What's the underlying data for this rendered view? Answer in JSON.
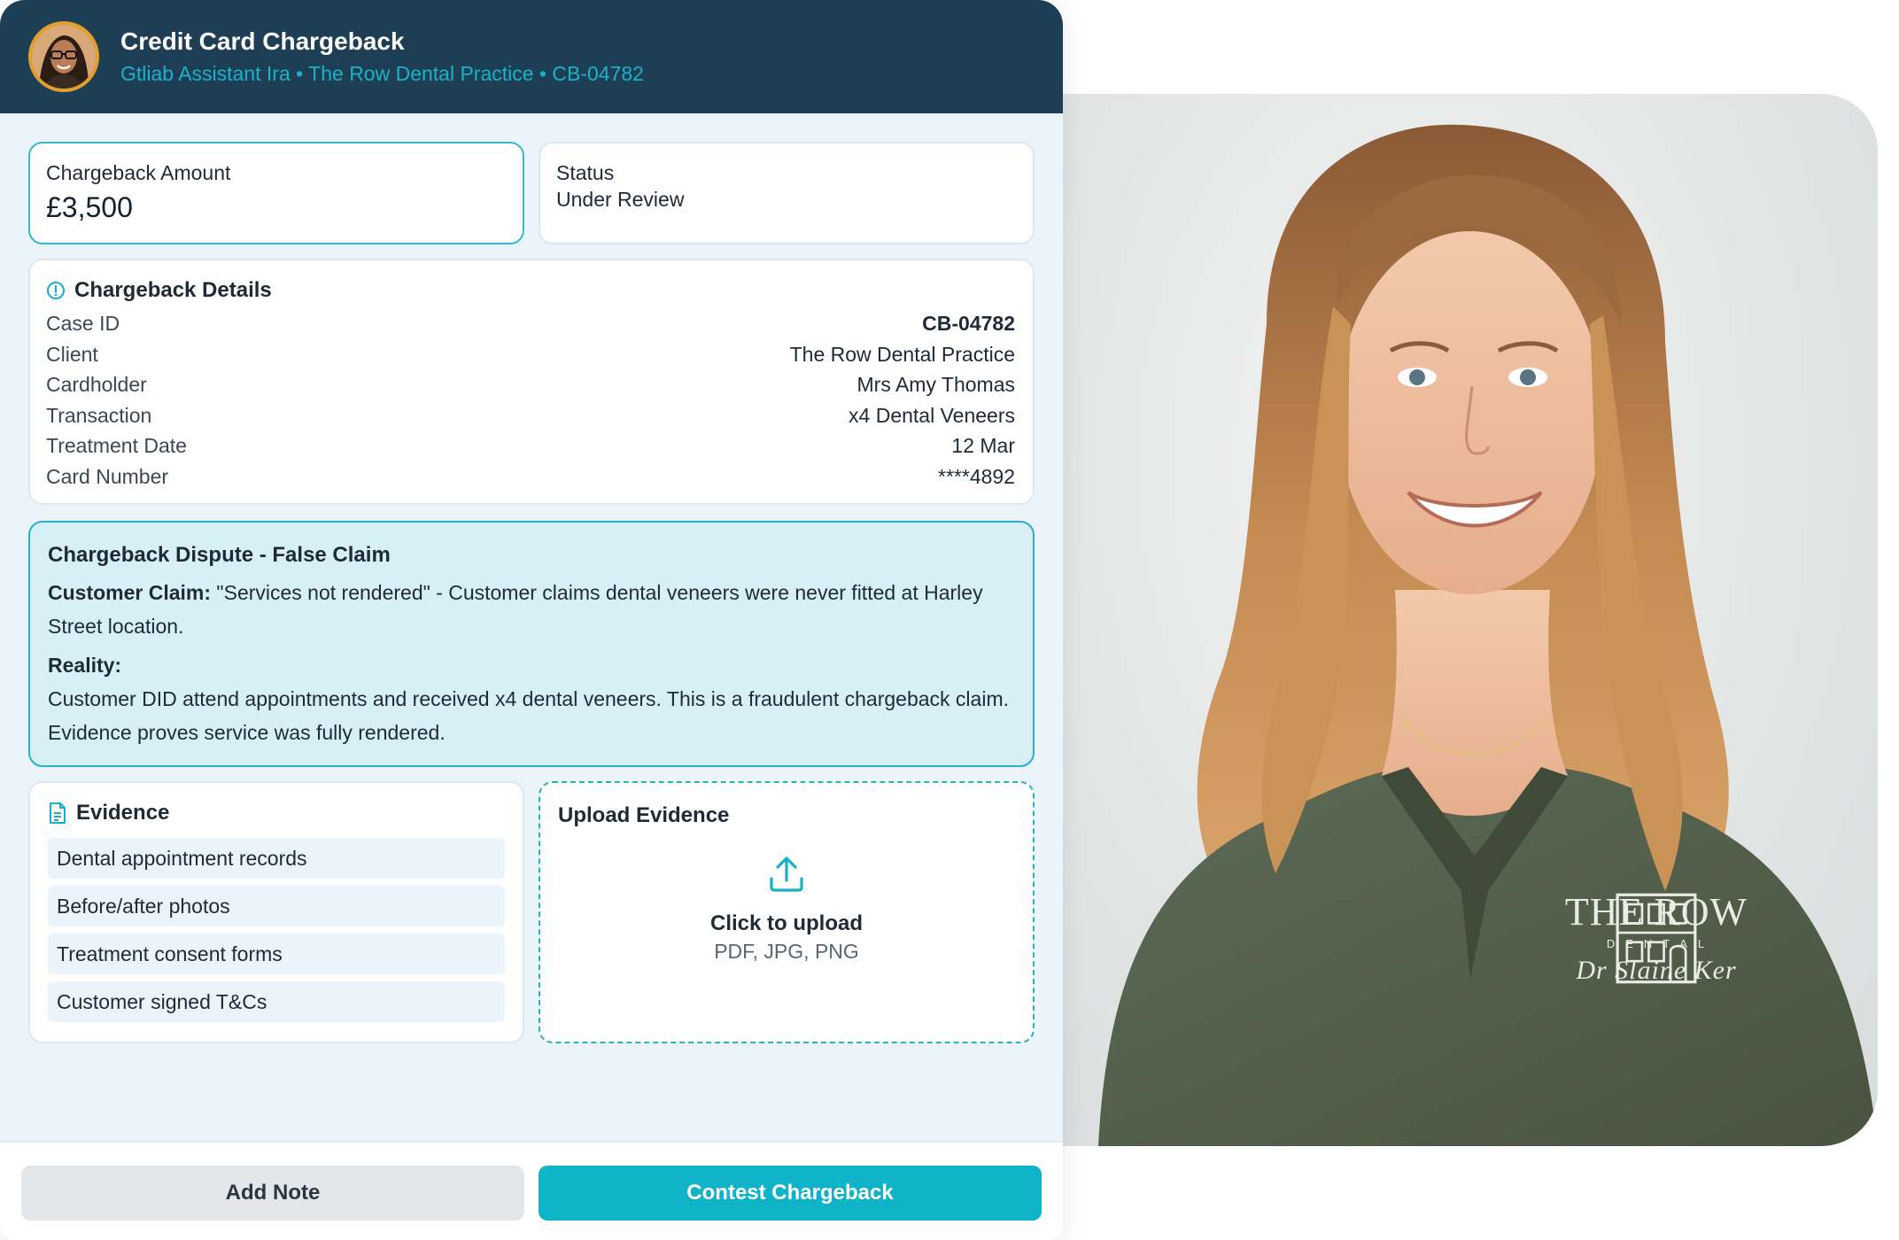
{
  "header": {
    "title": "Credit Card Chargeback",
    "subtitle": "Gtliab Assistant Ira • The Row Dental Practice • CB-04782",
    "avatar_icon": "user-avatar-photo"
  },
  "summary": {
    "amount_label": "Chargeback Amount",
    "amount_value": "£3,500",
    "status_label": "Status",
    "status_value": "Under Review"
  },
  "details": {
    "title": "Chargeback Details",
    "icon": "info-circle-icon",
    "rows": [
      {
        "label": "Case ID",
        "value": "CB-04782"
      },
      {
        "label": "Client",
        "value": "The Row Dental Practice"
      },
      {
        "label": "Cardholder",
        "value": "Mrs Amy Thomas"
      },
      {
        "label": "Transaction",
        "value": "x4 Dental Veneers"
      },
      {
        "label": "Treatment Date",
        "value": "12 Mar"
      },
      {
        "label": "Card Number",
        "value": "****4892"
      }
    ]
  },
  "dispute": {
    "title": "Chargeback Dispute - False Claim",
    "claim_label": "Customer Claim:",
    "claim_text": " \"Services not rendered\" - Customer claims dental veneers were never fitted at Harley Street location.",
    "reality_label": "Reality:",
    "reality_text": "Customer DID attend appointments and received x4 dental veneers. This is a fraudulent chargeback claim. Evidence proves service was fully rendered."
  },
  "evidence": {
    "title": "Evidence",
    "icon": "document-icon",
    "items": [
      "Dental appointment records",
      "Before/after photos",
      "Treatment consent forms",
      "Customer signed T&Cs"
    ]
  },
  "upload": {
    "title": "Upload Evidence",
    "icon": "upload-icon",
    "main": "Click to upload",
    "types": "PDF, JPG, PNG"
  },
  "footer": {
    "note_label": "Add Note",
    "contest_label": "Contest Chargeback"
  },
  "photo": {
    "logo_name": "THE ROW",
    "logo_sub": "DENTAL",
    "doctor": "Dr Slaine Ker"
  },
  "colors": {
    "header_bg": "#1d3e55",
    "accent": "#0fb3c8",
    "panel_bg": "#eaf4fa"
  }
}
